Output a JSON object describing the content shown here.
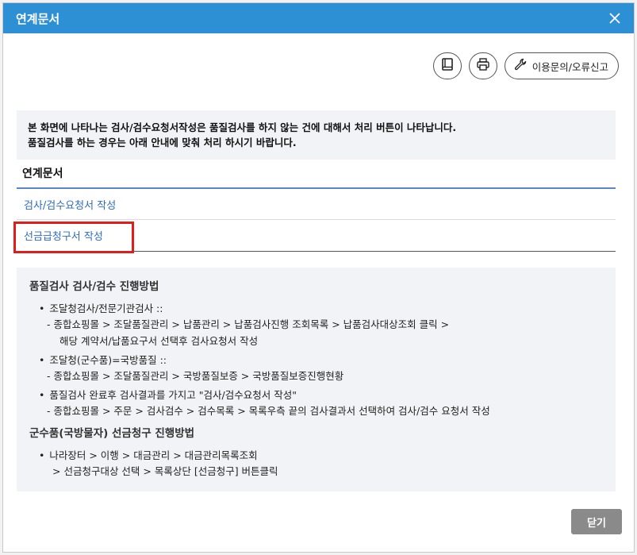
{
  "dialog": {
    "title": "연계문서"
  },
  "toolbar": {
    "manual_icon": "book-icon",
    "print_icon": "printer-icon",
    "support_icon": "wrench-icon",
    "support_label": "이용문의/오류신고"
  },
  "notice": {
    "line1": "본 화면에 나타나는 검사/검수요청서작성은 품질검사를 하지 않는 건에 대해서 처리 버튼이 나타납니다.",
    "line2": "품질검사를 하는 경우는 아래 안내에 맞춰 처리 하시기 바랍니다."
  },
  "section": {
    "title": "연계문서",
    "links": [
      "검사/검수요청서 작성",
      "선금급청구서 작성"
    ]
  },
  "guide": {
    "heading1": "품질검사 검사/검수 진행방법",
    "b1": "조달청검사/전문기관검사 ::",
    "b1_l1": "- 종합쇼핑몰 > 조달품질관리 > 납품관리 > 납품검사진행 조회목록 > 납품검사대상조회 클릭 >",
    "b1_l2": "해당 계약서/납품요구서 선택후 검사요청서 작성",
    "b2": "조달청(군수품)=국방품질 ::",
    "b2_l1": "- 종합쇼핑몰 > 조달품질관리 > 국방품질보증 > 국방품질보증진행현황",
    "b3": "품질검사 완료후 검사결과를 가지고 \"검사/검수요청서 작성\"",
    "b3_l1": "- 종합쇼핑몰 > 주문 > 검사검수 > 검수목록 > 목록우측 끝의 검사결과서 선택하여 검사/검수 요청서 작성",
    "heading2": "군수품(국방물자) 선금청구 진행방법",
    "b4": "나라장터 > 이행 > 대금관리 > 대금관리목록조회",
    "b4_l1": "> 선금청구대상 선택 > 목록상단 [선금청구] 버튼클릭"
  },
  "footer": {
    "close_label": "닫기"
  },
  "colors": {
    "titlebar": "#2d8fd4",
    "link": "#2e6bc4",
    "highlight": "#e21b1b",
    "panel": "#f1f3f6",
    "close_button": "#8a8a8a"
  }
}
